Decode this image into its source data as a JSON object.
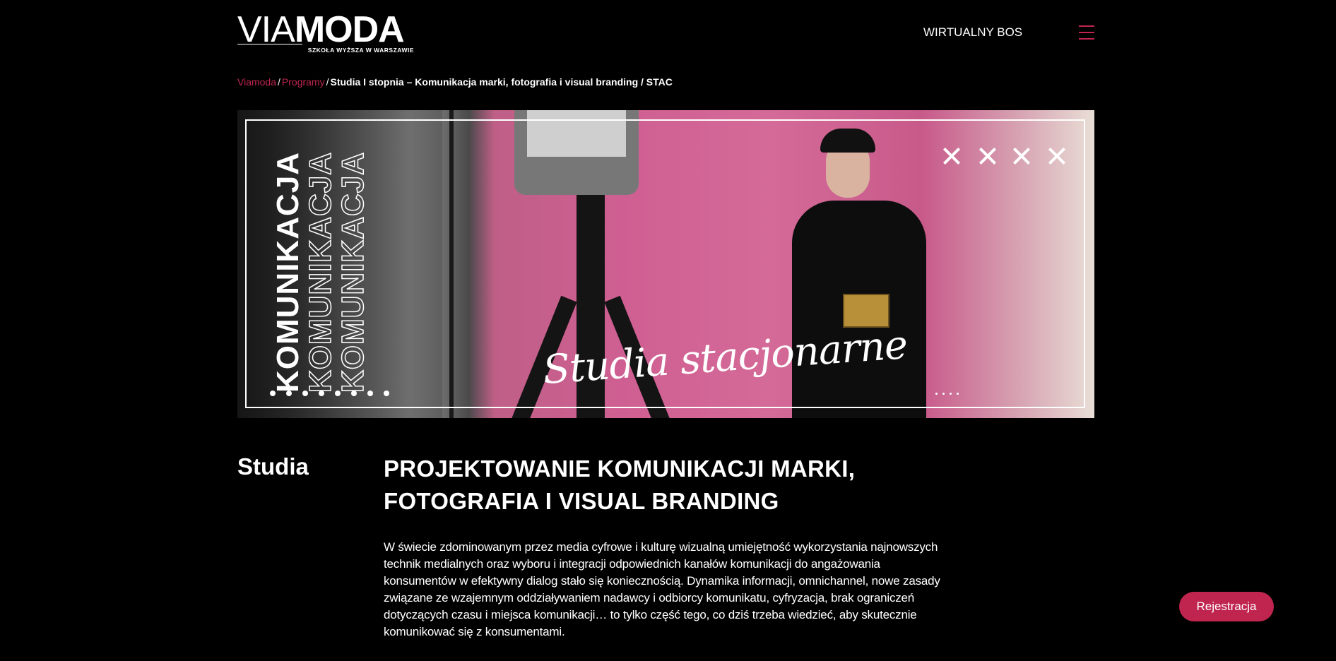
{
  "header": {
    "logo_via": "VIA",
    "logo_moda": "MODA",
    "logo_tagline": "SZKOŁA WYŻSZA W WARSZAWIE",
    "nav_link": "WIRTUALNY BOS",
    "menu_icon": "hamburger-icon"
  },
  "breadcrumb": {
    "items": [
      "Viamoda",
      "Programy"
    ],
    "separator": "/",
    "current": "Studia I stopnia – Komunikacja marki, fotografia i visual branding / STAC"
  },
  "banner": {
    "vertical_word": "KOMUNIKACJA",
    "script_title": "Studia stacjonarne",
    "cross_icon": "x-icon"
  },
  "content": {
    "section_label": "Studia",
    "heading": "PROJEKTOWANIE KOMUNIKACJI MARKI, FOTOGRAFIA I VISUAL BRANDING",
    "intro": "W świecie zdominowanym przez media cyfrowe i kulturę wizualną umiejętność wykorzystania najnowszych technik medialnych oraz wyboru i integracji odpowiednich kanałów komunikacji do angażowania konsumentów w efektywny dialog stało się koniecznością. Dynamika informacji, omnichannel, nowe zasady związane ze wzajemnym oddziaływaniem nadawcy i odbiorcy komunikatu, cyfryzacja, brak ograniczeń dotyczących czasu i miejsca komunikacji… to tylko część tego, co dziś trzeba wiedzieć, aby skutecznie komunikować się z konsumentami."
  },
  "actions": {
    "register_label": "Rejestracja"
  },
  "colors": {
    "accent": "#c0254f",
    "background": "#000000",
    "text": "#ffffff"
  }
}
